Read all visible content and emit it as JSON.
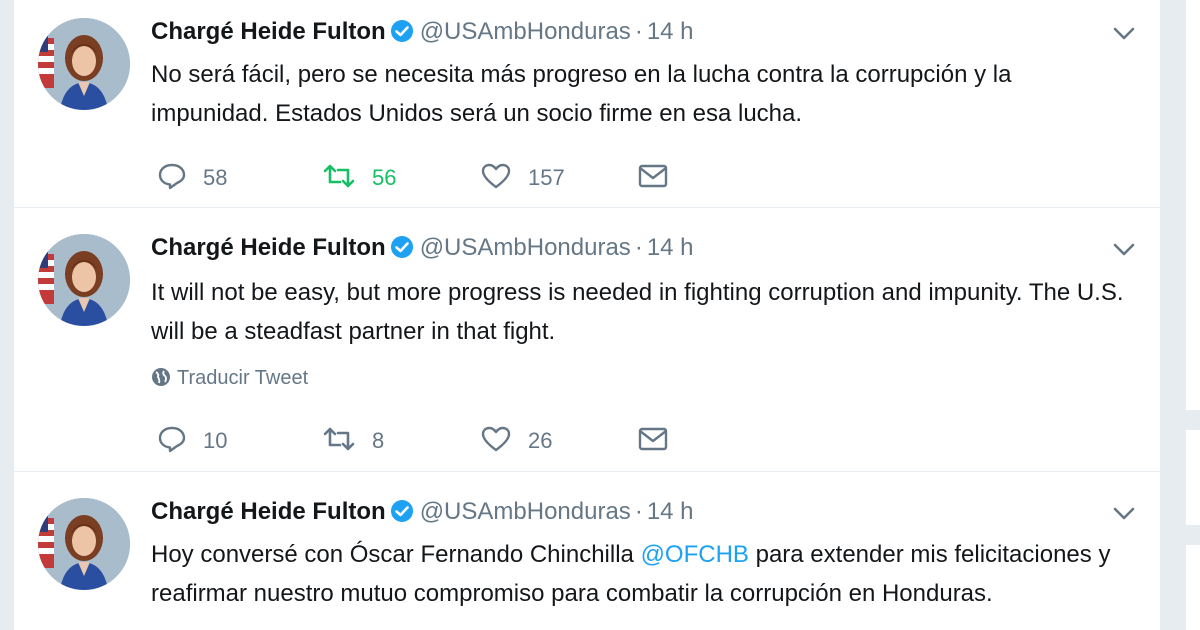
{
  "colors": {
    "link": "#1da1f2",
    "secondary_text": "#657786",
    "primary_text": "#14171a",
    "retweeted_green": "#17bf63",
    "verified_blue": "#1da1f2",
    "background": "#e6ecf0"
  },
  "tweets": [
    {
      "author_name": "Chargé Heide Fulton",
      "handle": "@USAmbHonduras",
      "separator": "·",
      "time": "14 h",
      "text": "No será fácil, pero se necesita más progreso en la lucha contra la corrupción y la impunidad. Estados Unidos será un socio firme en esa lucha.",
      "reply_count": "58",
      "retweet_count": "56",
      "like_count": "157",
      "retweeted": true
    },
    {
      "author_name": "Chargé Heide Fulton",
      "handle": "@USAmbHonduras",
      "separator": "·",
      "time": "14 h",
      "text": "It will not be easy, but more progress is needed in fighting corruption and impunity. The U.S. will be a steadfast partner in that fight.",
      "translate_label": "Traducir Tweet",
      "reply_count": "10",
      "retweet_count": "8",
      "like_count": "26",
      "retweeted": false
    },
    {
      "author_name": "Chargé Heide Fulton",
      "handle": "@USAmbHonduras",
      "separator": "·",
      "time": "14 h",
      "text_before_mention": "Hoy conversé con Óscar Fernando Chinchilla ",
      "mention": "@OFCHB",
      "text_after_mention": " para extender mis felicitaciones y reafirmar nuestro mutuo compromiso para combatir la corrupción en Honduras."
    }
  ],
  "icons": {
    "verified": "verified-badge-icon",
    "caret": "chevron-down-icon",
    "reply": "reply-icon",
    "retweet": "retweet-icon",
    "like": "heart-icon",
    "message": "envelope-icon",
    "translate": "globe-icon"
  }
}
